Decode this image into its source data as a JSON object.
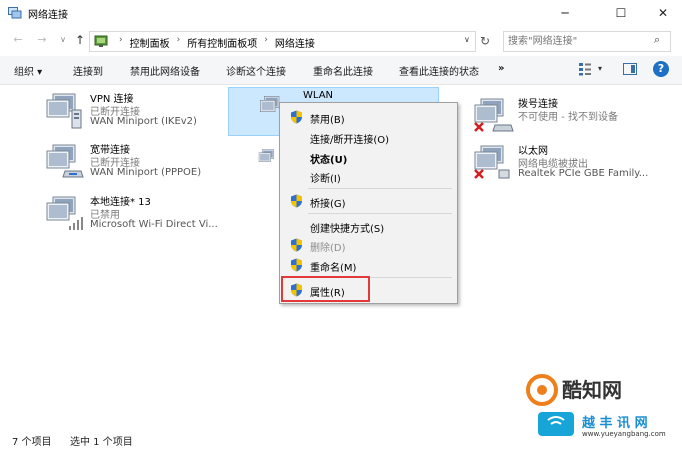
{
  "window": {
    "title": "网络连接",
    "controls": {
      "minimize": "─",
      "maximize": "☐",
      "close": "✕"
    }
  },
  "nav": {
    "back": "←",
    "forward": "→",
    "recent": "∨",
    "up": "↑"
  },
  "address": {
    "crumbs": [
      "控制面板",
      "所有控制面板项",
      "网络连接"
    ],
    "separator": "›",
    "dropdown": "∨",
    "refresh": "↻"
  },
  "search": {
    "placeholder": "搜索\"网络连接\"",
    "icon": "search-icon"
  },
  "toolbar": {
    "organize": "组织 ▾",
    "connect": "连接到",
    "disable": "禁用此网络设备",
    "diagnose": "诊断这个连接",
    "rename": "重命名此连接",
    "status": "查看此连接的状态",
    "more": "»",
    "view_drop": "▾",
    "help": "?"
  },
  "connections": [
    {
      "name": "VPN 连接",
      "status": "已断开连接",
      "device": "WAN Miniport (IKEv2)"
    },
    {
      "name": "宽带连接",
      "status": "已断开连接",
      "device": "WAN Miniport (PPPOE)"
    },
    {
      "name": "本地连接* 13",
      "status": "已禁用",
      "device": "Microsoft Wi-Fi Direct Vi..."
    },
    {
      "name": "WLAN",
      "status": "",
      "device": ""
    },
    {
      "name": "拨号连接",
      "status": "不可使用 - 找不到设备",
      "device": ""
    },
    {
      "name": "以太网",
      "status": "网络电缆被拔出",
      "device": "Realtek PCIe GBE Family..."
    }
  ],
  "context_menu": {
    "items": [
      {
        "label": "禁用(B)"
      },
      {
        "label": "连接/断开连接(O)"
      },
      {
        "label": "状态(U)"
      },
      {
        "label": "诊断(I)"
      },
      {
        "label": "桥接(G)"
      },
      {
        "label": "创建快捷方式(S)"
      },
      {
        "label": "删除(D)"
      },
      {
        "label": "重命名(M)"
      },
      {
        "label": "属性(R)"
      }
    ]
  },
  "statusbar": {
    "count": "7 个项目",
    "selected": "选中 1 个项目"
  },
  "watermark": {
    "brand": "酷知网",
    "site_name": "越 丰 讯 网",
    "url": "www.yueyangbang.com"
  },
  "colors": {
    "accent": "#1e6fc6",
    "selection": "#cce8ff",
    "highlight": "#e03a3a",
    "shield_blue": "#2f6fd0",
    "shield_yellow": "#f5c400"
  }
}
